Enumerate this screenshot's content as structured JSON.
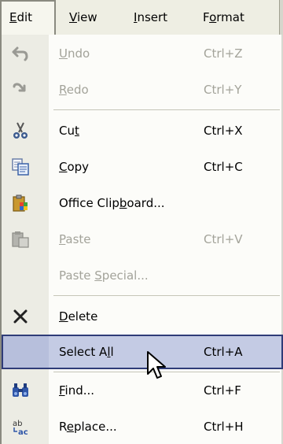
{
  "menubar": {
    "items": [
      {
        "pre": "",
        "u": "E",
        "post": "dit"
      },
      {
        "pre": "",
        "u": "V",
        "post": "iew"
      },
      {
        "pre": "",
        "u": "I",
        "post": "nsert"
      },
      {
        "pre": "F",
        "u": "o",
        "post": "rmat"
      }
    ]
  },
  "menu": {
    "items": [
      {
        "icon": "undo-icon",
        "pre": "",
        "u": "U",
        "post": "ndo",
        "shortcut": "Ctrl+Z",
        "disabled": true
      },
      {
        "icon": "redo-icon",
        "pre": "",
        "u": "R",
        "post": "edo",
        "shortcut": "Ctrl+Y",
        "disabled": true
      },
      {
        "icon": "scissors-icon",
        "pre": "Cu",
        "u": "t",
        "post": "",
        "shortcut": "Ctrl+X",
        "disabled": false
      },
      {
        "icon": "copy-icon",
        "pre": "",
        "u": "C",
        "post": "opy",
        "shortcut": "Ctrl+C",
        "disabled": false
      },
      {
        "icon": "clipboard-icon",
        "pre": "Office Clip",
        "u": "b",
        "post": "oard...",
        "shortcut": "",
        "disabled": false
      },
      {
        "icon": "paste-icon",
        "pre": "",
        "u": "P",
        "post": "aste",
        "shortcut": "Ctrl+V",
        "disabled": true
      },
      {
        "icon": "",
        "pre": "Paste ",
        "u": "S",
        "post": "pecial...",
        "shortcut": "",
        "disabled": true
      },
      {
        "icon": "delete-icon",
        "pre": "",
        "u": "D",
        "post": "elete",
        "shortcut": "",
        "disabled": false
      },
      {
        "icon": "",
        "pre": "Select A",
        "u": "l",
        "post": "l",
        "shortcut": "Ctrl+A",
        "disabled": false
      },
      {
        "icon": "binoculars-icon",
        "pre": "",
        "u": "F",
        "post": "ind...",
        "shortcut": "Ctrl+F",
        "disabled": false
      },
      {
        "icon": "replace-icon",
        "pre": "R",
        "u": "e",
        "post": "place...",
        "shortcut": "Ctrl+H",
        "disabled": false
      }
    ]
  },
  "colors": {
    "highlight": "#c4cbe4",
    "highlight_border": "#2f3c78",
    "menubar": "#eeeee3",
    "gutter": "#ecece4",
    "disabled_text": "#a3a39a"
  }
}
